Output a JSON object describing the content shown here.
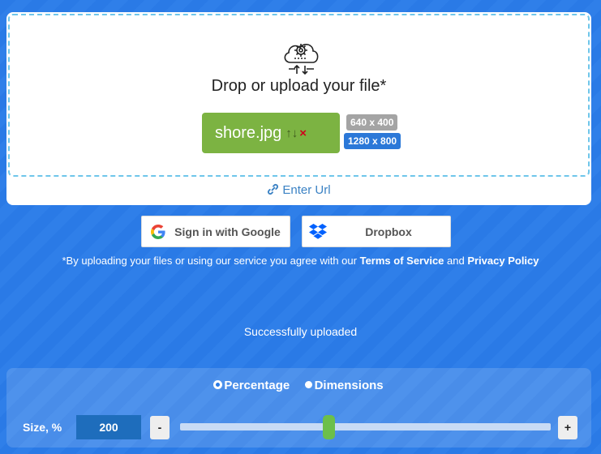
{
  "upload": {
    "drop_title": "Drop or upload your file*",
    "file_name": "shore.jpg",
    "actions": {
      "up": "↑",
      "down": "↓",
      "remove": "×"
    },
    "badges": [
      "640 x 400",
      "1280 x 800"
    ],
    "enter_url": "Enter Url"
  },
  "services": {
    "google": "Sign in with Google",
    "dropbox": "Dropbox"
  },
  "terms": {
    "prefix": "*By uploading your files or using our service you agree with our ",
    "tos": "Terms of Service",
    "and": " and ",
    "privacy": "Privacy Policy"
  },
  "status": "Successfully uploaded",
  "resize": {
    "mode_percentage": "Percentage",
    "mode_dimensions": "Dimensions",
    "selected_mode": "Percentage",
    "size_label": "Size, %",
    "size_value": "200",
    "minus": "-",
    "plus": "+",
    "slider_fraction": 0.4
  },
  "colors": {
    "background": "#2a7ae6",
    "file_chip": "#7cb342",
    "slider_thumb": "#6cbf4a",
    "dashed_border": "#6fc6ea"
  }
}
